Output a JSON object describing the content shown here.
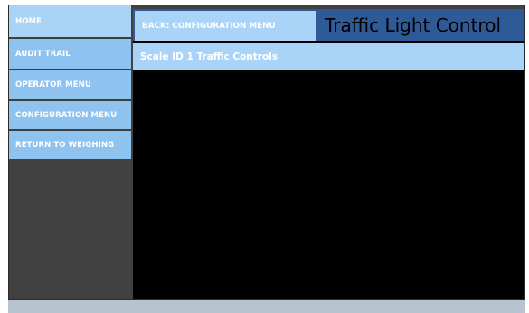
{
  "sidebar": {
    "items": [
      {
        "label": "HOME"
      },
      {
        "label": "AUDIT TRAIL"
      },
      {
        "label": "OPERATOR MENU"
      },
      {
        "label": "CONFIGURATION MENU"
      },
      {
        "label": "RETURN TO WEIGHING"
      }
    ]
  },
  "header": {
    "back_label": "BACK: CONFIGURATION MENU",
    "title": "Traffic Light Control"
  },
  "main": {
    "subtitle": "Scale ID 1 Traffic Controls"
  },
  "colors": {
    "nav_bg": "#8ec3f0",
    "nav_active_bg": "#a9d4f8",
    "header_bg": "#2f5a98",
    "panel_bg": "#000000",
    "frame_bg": "#414141"
  }
}
